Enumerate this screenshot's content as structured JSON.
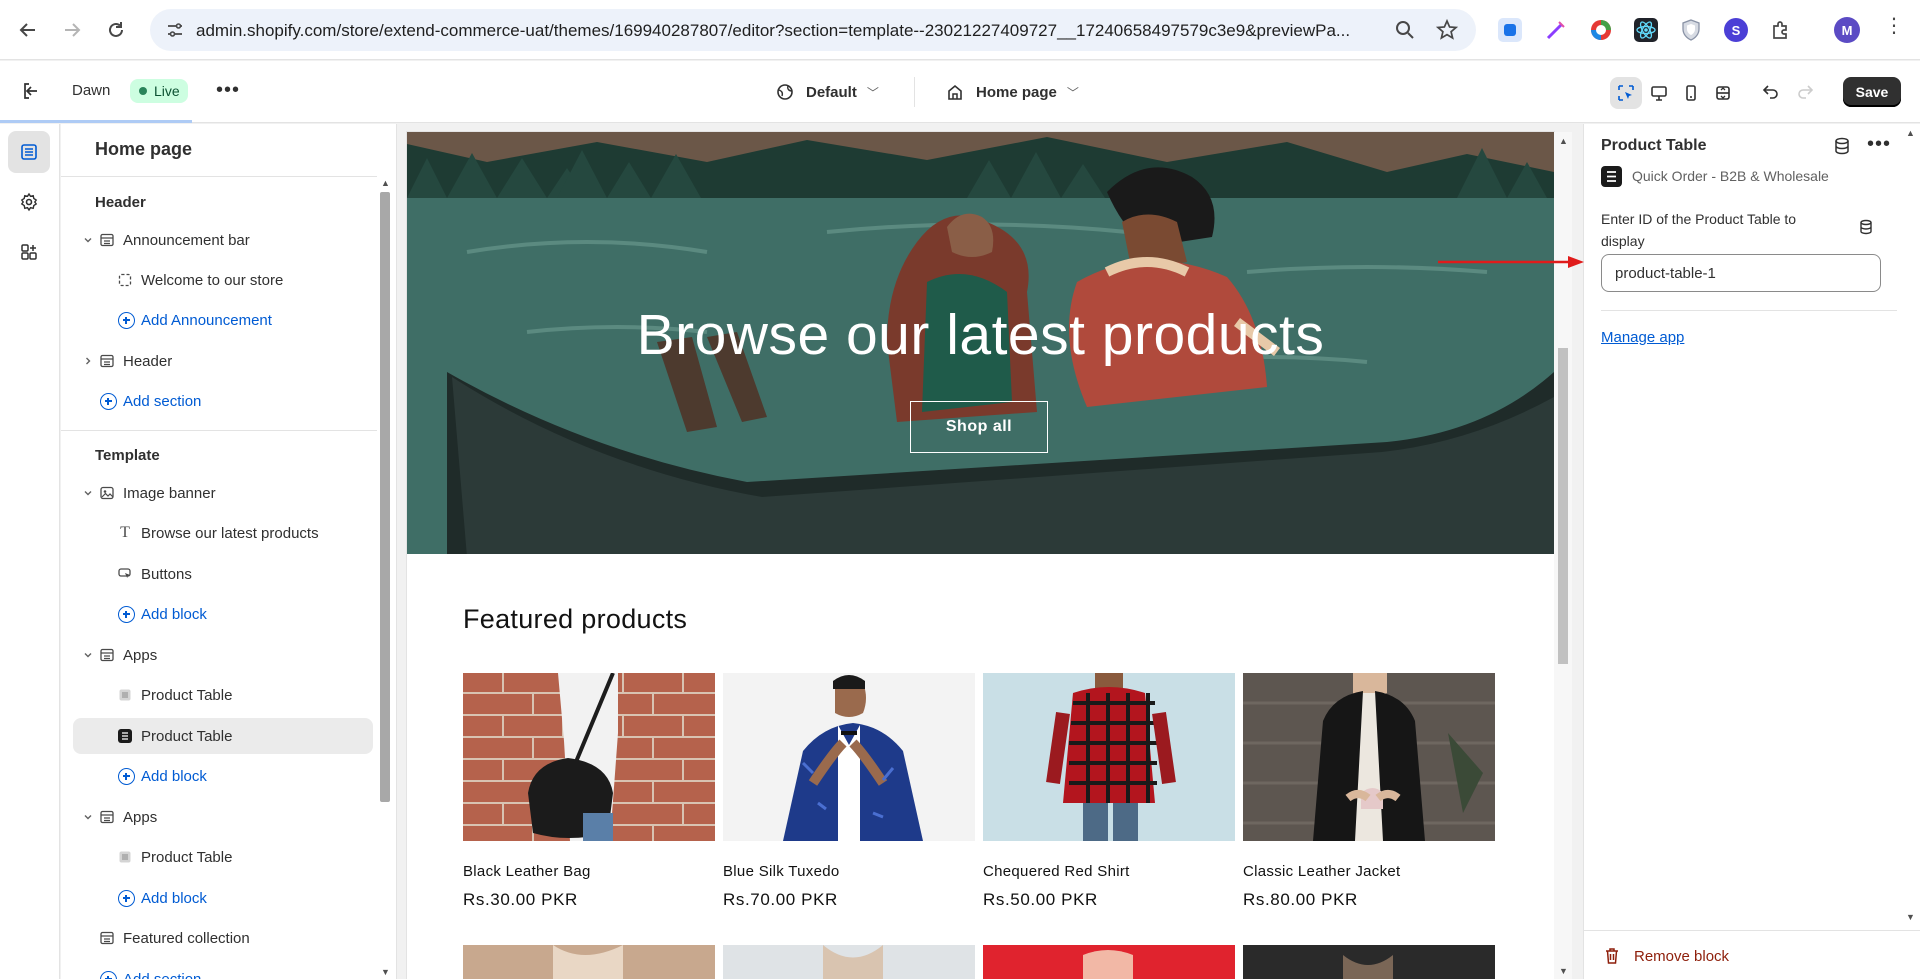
{
  "browser": {
    "url": "admin.shopify.com/store/extend-commerce-uat/themes/169940287807/editor?section=template--23021227409727__17240658497579c3e9&previewPa...",
    "profile_initial": "M"
  },
  "editor_header": {
    "theme_name": "Dawn",
    "live_badge": "Live",
    "theme_select": "Default",
    "page_select": "Home page",
    "save_label": "Save"
  },
  "sidebar": {
    "title": "Home page",
    "header_group": "Header",
    "template_group": "Template",
    "rows": {
      "announcement_bar": "Announcement bar",
      "welcome": "Welcome to our store",
      "add_announcement": "Add Announcement",
      "header": "Header",
      "add_section_1": "Add section",
      "image_banner": "Image banner",
      "browse": "Browse our latest products",
      "buttons": "Buttons",
      "add_block_1": "Add block",
      "apps_1": "Apps",
      "product_table_1": "Product Table",
      "product_table_2": "Product Table",
      "add_block_2": "Add block",
      "apps_2": "Apps",
      "product_table_3": "Product Table",
      "add_block_3": "Add block",
      "featured_collection": "Featured collection",
      "add_section_2": "Add section"
    }
  },
  "preview": {
    "banner_heading": "Browse our latest products",
    "banner_button": "Shop all",
    "featured_heading": "Featured products",
    "products": [
      {
        "name": "Black Leather Bag",
        "price": "Rs.30.00 PKR"
      },
      {
        "name": "Blue Silk Tuxedo",
        "price": "Rs.70.00 PKR"
      },
      {
        "name": "Chequered Red Shirt",
        "price": "Rs.50.00 PKR"
      },
      {
        "name": "Classic Leather Jacket",
        "price": "Rs.80.00 PKR"
      }
    ]
  },
  "right_panel": {
    "title": "Product Table",
    "app_name": "Quick Order - B2B & Wholesale",
    "field_label": "Enter ID of the Product Table to display",
    "field_value": "product-table-1",
    "manage_link": "Manage app",
    "remove_label": "Remove block"
  },
  "colors": {
    "accent_blue": "#005bd3",
    "live_green": "#29845a",
    "remove_red": "#8e1f0b",
    "annotation_arrow": "#e01b1b",
    "banner_teal": "#3f6e66"
  }
}
